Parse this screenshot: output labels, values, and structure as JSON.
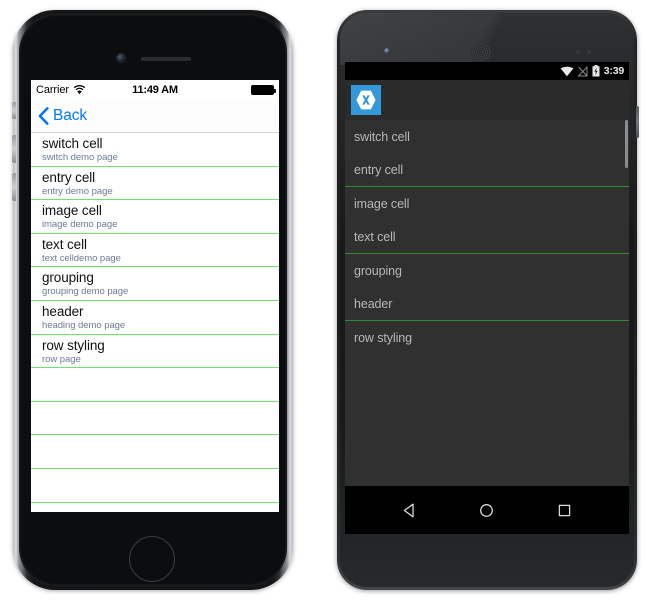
{
  "ios": {
    "status_bar": {
      "carrier": "Carrier",
      "wifi_icon": "wifi-icon",
      "time": "11:49 AM",
      "battery_icon": "battery-full-icon"
    },
    "nav_bar": {
      "back_icon": "chevron-left-icon",
      "back_label": "Back"
    },
    "list": {
      "rows": [
        {
          "title": "switch cell",
          "detail": "switch demo page"
        },
        {
          "title": "entry cell",
          "detail": "entry demo page"
        },
        {
          "title": "image cell",
          "detail": "image demo page"
        },
        {
          "title": "text cell",
          "detail": "text celldemo page"
        },
        {
          "title": "grouping",
          "detail": "grouping demo page"
        },
        {
          "title": "header",
          "detail": "heading demo page"
        },
        {
          "title": "row styling",
          "detail": "row page"
        }
      ],
      "empty_row_count": 5,
      "separator_color": "#6ee46e",
      "title_color": "#111111",
      "detail_color": "#6b7b99"
    },
    "hardware": {
      "camera": "front-camera",
      "speaker": "earpiece-speaker",
      "home_button": "home-button",
      "silent_switch": "silent-switch",
      "volume_up": "volume-up-button",
      "volume_down": "volume-down-button"
    }
  },
  "android": {
    "status_bar": {
      "wifi_icon": "wifi-icon",
      "signal_icon": "no-signal-icon",
      "battery_icon": "battery-charging-icon",
      "time": "3:39"
    },
    "action_bar": {
      "app_icon": "xamarin-logo-icon",
      "icon_bg_color": "#3498db"
    },
    "list": {
      "rows": [
        {
          "label": "switch cell",
          "separator_after": false
        },
        {
          "label": "entry cell",
          "separator_after": true
        },
        {
          "label": "image cell",
          "separator_after": false
        },
        {
          "label": "text cell",
          "separator_after": true
        },
        {
          "label": "grouping",
          "separator_after": false
        },
        {
          "label": "header",
          "separator_after": true
        },
        {
          "label": "row styling",
          "separator_after": false
        }
      ],
      "separator_color": "#2e8b2e",
      "label_color": "#b8b8b8",
      "background_color": "#303030"
    },
    "nav_bar": {
      "back_icon": "back-triangle-icon",
      "home_icon": "home-circle-icon",
      "recents_icon": "recents-square-icon"
    },
    "hardware": {
      "camera": "front-camera",
      "speaker": "earpiece-speaker",
      "sensors": "proximity-sensors",
      "side_button": "power-button"
    }
  }
}
